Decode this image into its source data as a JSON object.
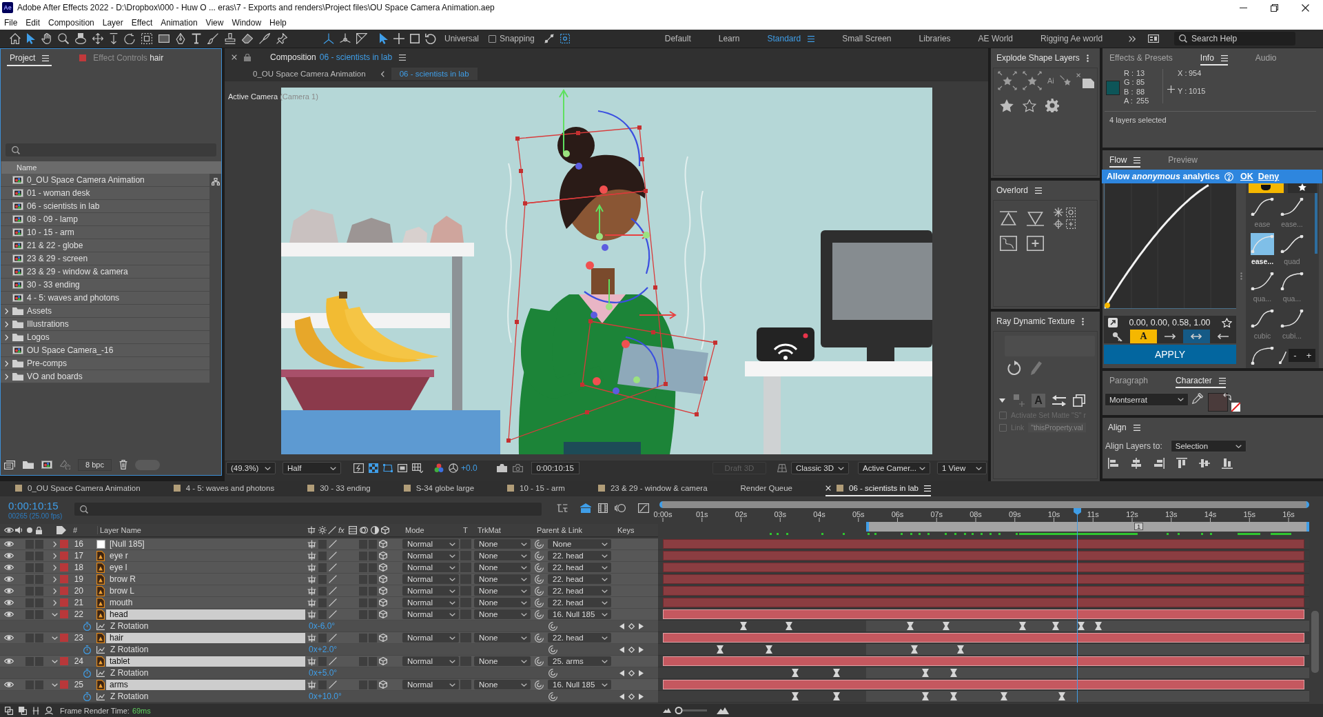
{
  "window": {
    "app_badge": "Ae",
    "title": "Adobe After Effects 2022 - D:\\Dropbox\\000 - Huw O ... eras\\7 - Exports and renders\\Project files\\OU Space Camera  Animation.aep"
  },
  "menu": [
    "File",
    "Edit",
    "Composition",
    "Layer",
    "Effect",
    "Animation",
    "View",
    "Window",
    "Help"
  ],
  "toolbar": {
    "tools": [
      {
        "kind": "selection",
        "selected": true
      },
      {
        "kind": "hand",
        "selected": false
      },
      {
        "kind": "zoom",
        "selected": false
      },
      {
        "kind": "orbit",
        "selected": false
      },
      {
        "kind": "pan",
        "selected": false
      },
      {
        "kind": "dolly",
        "selected": false
      },
      {
        "kind": "rotation",
        "selected": false
      },
      {
        "kind": "region",
        "selected": false
      },
      {
        "kind": "rectangle",
        "selected": false
      },
      {
        "kind": "pen",
        "selected": false
      },
      {
        "kind": "type",
        "selected": false
      },
      {
        "kind": "brush",
        "selected": false
      },
      {
        "kind": "stamp",
        "selected": false
      },
      {
        "kind": "eraser",
        "selected": false
      },
      {
        "kind": "roto",
        "selected": false
      },
      {
        "kind": "puppet",
        "selected": false
      }
    ],
    "axis_modes": [
      {
        "kind": "local",
        "selected": true
      },
      {
        "kind": "world",
        "selected": false
      },
      {
        "kind": "view",
        "selected": false
      }
    ],
    "transform_modes": [
      {
        "kind": "universal",
        "selected": true
      },
      {
        "kind": "move",
        "selected": false
      },
      {
        "kind": "scale",
        "selected": false
      },
      {
        "kind": "rotate",
        "selected": false
      }
    ],
    "mode_label": "Universal",
    "snapping": {
      "label": "Snapping",
      "checked": false
    },
    "snap_options": [
      {
        "kind": "line",
        "on": false
      },
      {
        "kind": "box",
        "on": true
      }
    ],
    "workspaces": [
      {
        "label": "Default",
        "selected": false
      },
      {
        "label": "Learn",
        "selected": false
      },
      {
        "label": "Standard",
        "selected": true
      },
      {
        "label": "Small Screen",
        "selected": false
      },
      {
        "label": "Libraries",
        "selected": false
      },
      {
        "label": "AE World",
        "selected": false
      },
      {
        "label": "Rigging Ae world",
        "selected": false
      }
    ],
    "search": {
      "placeholder": "Search Help"
    }
  },
  "project": {
    "tabs": [
      {
        "label": "Project",
        "selected": true
      },
      {
        "label": "Effect Controls",
        "target": "hair",
        "selected": false
      }
    ],
    "column": "Name",
    "items": [
      {
        "kind": "comp",
        "name": "0_OU Space Camera Animation"
      },
      {
        "kind": "comp",
        "name": "01 - woman desk"
      },
      {
        "kind": "comp",
        "name": "06 - scientists in lab"
      },
      {
        "kind": "comp",
        "name": "08 - 09 - lamp"
      },
      {
        "kind": "comp",
        "name": "10 - 15 - arm"
      },
      {
        "kind": "comp",
        "name": "21 & 22 - globe"
      },
      {
        "kind": "comp",
        "name": "23 & 29 - screen"
      },
      {
        "kind": "comp",
        "name": "23 & 29 - window & camera"
      },
      {
        "kind": "comp",
        "name": "30 - 33 ending"
      },
      {
        "kind": "comp",
        "name": "4 - 5: waves and photons"
      },
      {
        "kind": "folder",
        "name": "Assets",
        "expanded": false
      },
      {
        "kind": "folder",
        "name": "Illustrations",
        "expanded": false
      },
      {
        "kind": "folder",
        "name": "Logos",
        "expanded": false
      },
      {
        "kind": "comp",
        "name": "OU Space Camera_-16"
      },
      {
        "kind": "folder",
        "name": "Pre-comps",
        "expanded": false
      },
      {
        "kind": "folder",
        "name": "VO and boards",
        "expanded": false
      }
    ],
    "bpc": "8 bpc"
  },
  "composition": {
    "tab": {
      "label": "Composition",
      "name": "06 - scientists in lab"
    },
    "breadcrumbs": [
      {
        "label": "0_OU Space Camera Animation",
        "selected": false
      },
      {
        "label": "06 - scientists in lab",
        "selected": true
      }
    ],
    "view": {
      "label": "Active Camera",
      "camera": "(Camera 1)"
    },
    "footer": {
      "zoom": "(49.3%)",
      "resolution": "Half",
      "toggles": [
        {
          "kind": "fast-preview",
          "on": false
        },
        {
          "kind": "transparency-grid",
          "on": true
        },
        {
          "kind": "mask-path",
          "on": true
        },
        {
          "kind": "region",
          "on": false
        },
        {
          "kind": "grid",
          "on": false
        }
      ],
      "exposure": "+0.0",
      "timecode": "0:00:10:15",
      "draft": {
        "label": "Draft 3D",
        "disabled": true
      },
      "renderer": "Classic 3D",
      "camera": "Active Camer...",
      "layout": "1 View"
    }
  },
  "explode": {
    "title": "Explode Shape Layers",
    "ai_label": "Ai"
  },
  "overlord": {
    "title": "Overlord"
  },
  "ray": {
    "title": "Ray Dynamic Texture",
    "letter": "A",
    "options": [
      {
        "label": "Activate Set Matte \"S\" r",
        "checked": false,
        "disabled": true
      },
      {
        "label": "Link",
        "checked": false,
        "disabled": true,
        "value": "\"thisProperty.val"
      }
    ]
  },
  "info": {
    "tabs": [
      {
        "label": "Effects & Presets",
        "selected": false
      },
      {
        "label": "Info",
        "selected": true
      },
      {
        "label": "Audio",
        "selected": false
      }
    ],
    "channels": [
      {
        "label": "R :",
        "value": "13"
      },
      {
        "label": "G :",
        "value": "85"
      },
      {
        "label": "B :",
        "value": "88"
      },
      {
        "label": "A :",
        "value": "255"
      }
    ],
    "position": [
      {
        "label": "X :",
        "value": "954"
      },
      {
        "label": "Y :",
        "value": "1015"
      }
    ],
    "status": "4 layers selected"
  },
  "flow": {
    "tabs": [
      {
        "label": "Flow",
        "selected": true
      },
      {
        "label": "Preview",
        "selected": false
      }
    ],
    "banner": {
      "text": "Allow *anonymous* analytics",
      "ok": "OK",
      "deny": "Deny"
    },
    "values": "0.00, 0.00, 0.58, 1.00",
    "buttons": [
      {
        "kind": "key",
        "on": false
      },
      {
        "kind": "letter",
        "label": "A",
        "on": true
      },
      {
        "kind": "out",
        "on": false
      },
      {
        "kind": "both",
        "on": true
      },
      {
        "kind": "in",
        "on": false
      }
    ],
    "apply": "APPLY",
    "presets": [
      {
        "label": "ease",
        "selected": false
      },
      {
        "label": "ease...",
        "selected": false
      },
      {
        "label": "ease...",
        "selected": true
      },
      {
        "label": "quad",
        "selected": false
      },
      {
        "label": "qua...",
        "selected": false
      },
      {
        "label": "qua...",
        "selected": false
      },
      {
        "label": "cubic",
        "selected": false
      },
      {
        "label": "cubi...",
        "selected": false
      },
      {
        "selected": false
      },
      {
        "selected": false
      }
    ],
    "zoom": [
      "-",
      "+"
    ]
  },
  "character": {
    "tabs": [
      {
        "label": "Paragraph",
        "selected": false
      },
      {
        "label": "Character",
        "selected": true
      }
    ],
    "font": "Montserrat"
  },
  "align": {
    "title": "Align",
    "label": "Align Layers to:",
    "target": "Selection"
  },
  "timeline": {
    "tabs": [
      {
        "kind": "comp",
        "label": "0_OU Space Camera Animation",
        "selected": false
      },
      {
        "kind": "comp",
        "label": "4 - 5: waves and photons",
        "selected": false
      },
      {
        "kind": "comp",
        "label": "30 - 33 ending",
        "selected": false
      },
      {
        "kind": "comp",
        "label": "S-34 globe large",
        "selected": false
      },
      {
        "kind": "comp",
        "label": "10 - 15 - arm",
        "selected": false
      },
      {
        "kind": "comp",
        "label": "23 & 29 - window & camera",
        "selected": false
      },
      {
        "kind": "queue",
        "label": "Render Queue",
        "selected": false
      },
      {
        "kind": "comp",
        "label": "06 - scientists in lab",
        "selected": true
      }
    ],
    "timecode": "0:00:10:15",
    "frames": "00265 (25.00 fps)",
    "switches": [
      {
        "kind": "flowchart",
        "on": false
      },
      {
        "kind": "draft-3d",
        "on": true
      },
      {
        "kind": "frame-blending",
        "on": false
      },
      {
        "kind": "motion-blur",
        "on": false
      },
      {
        "kind": "graph-editor",
        "on": false
      }
    ],
    "columns": {
      "number": "#",
      "name": "Layer Name",
      "fx": "fx",
      "mode": "Mode",
      "t": "T",
      "trkmat": "TrkMat",
      "parent": "Parent & Link",
      "keys": "Keys"
    },
    "ruler": [
      "0:00s",
      "01s",
      "02s",
      "03s",
      "04s",
      "05s",
      "06s",
      "07s",
      "08s",
      "09s",
      "10s",
      "11s",
      "12s",
      "13s",
      "14s",
      "15s",
      "16s"
    ],
    "marker": "1",
    "layers": [
      {
        "number": "16",
        "name": "[Null 185]",
        "kind": "null",
        "visible": true,
        "expanded": false,
        "selected": false,
        "mode": "Normal",
        "trkmat": "None",
        "parent": "None"
      },
      {
        "number": "17",
        "name": "eye r",
        "kind": "art",
        "visible": true,
        "expanded": false,
        "selected": false,
        "mode": "Normal",
        "trkmat": "None",
        "parent": "22. head"
      },
      {
        "number": "18",
        "name": "eye l",
        "kind": "art",
        "visible": true,
        "expanded": false,
        "selected": false,
        "mode": "Normal",
        "trkmat": "None",
        "parent": "22. head"
      },
      {
        "number": "19",
        "name": "brow R",
        "kind": "art",
        "visible": true,
        "expanded": false,
        "selected": false,
        "mode": "Normal",
        "trkmat": "None",
        "parent": "22. head"
      },
      {
        "number": "20",
        "name": "brow L",
        "kind": "art",
        "visible": true,
        "expanded": false,
        "selected": false,
        "mode": "Normal",
        "trkmat": "None",
        "parent": "22. head"
      },
      {
        "number": "21",
        "name": "mouth",
        "kind": "art",
        "visible": true,
        "expanded": false,
        "selected": false,
        "mode": "Normal",
        "trkmat": "None",
        "parent": "22. head"
      },
      {
        "number": "22",
        "name": "head",
        "kind": "art",
        "visible": true,
        "expanded": true,
        "selected": true,
        "mode": "Normal",
        "trkmat": "None",
        "parent": "16. Null 185",
        "property": {
          "name": "Z Rotation",
          "value": "0x-6.0°"
        }
      },
      {
        "number": "23",
        "name": "hair",
        "kind": "art",
        "visible": true,
        "expanded": true,
        "selected": true,
        "mode": "Normal",
        "trkmat": "None",
        "parent": "22. head",
        "property": {
          "name": "Z Rotation",
          "value": "0x+2.0°"
        }
      },
      {
        "number": "24",
        "name": "tablet",
        "kind": "art",
        "visible": true,
        "expanded": true,
        "selected": true,
        "mode": "Normal",
        "trkmat": "None",
        "parent": "25. arms",
        "property": {
          "name": "Z Rotation",
          "value": "0x+5.0°"
        }
      },
      {
        "number": "25",
        "name": "arms",
        "kind": "art",
        "visible": true,
        "expanded": true,
        "selected": true,
        "mode": "Normal",
        "trkmat": "None",
        "parent": "16. Null 185",
        "property": {
          "name": "Z Rotation",
          "value": "0x+10.0°"
        }
      }
    ],
    "zoom_slider": {
      "level": 0.1
    },
    "status": {
      "label": "Frame Render Time:",
      "value": "69ms"
    }
  }
}
